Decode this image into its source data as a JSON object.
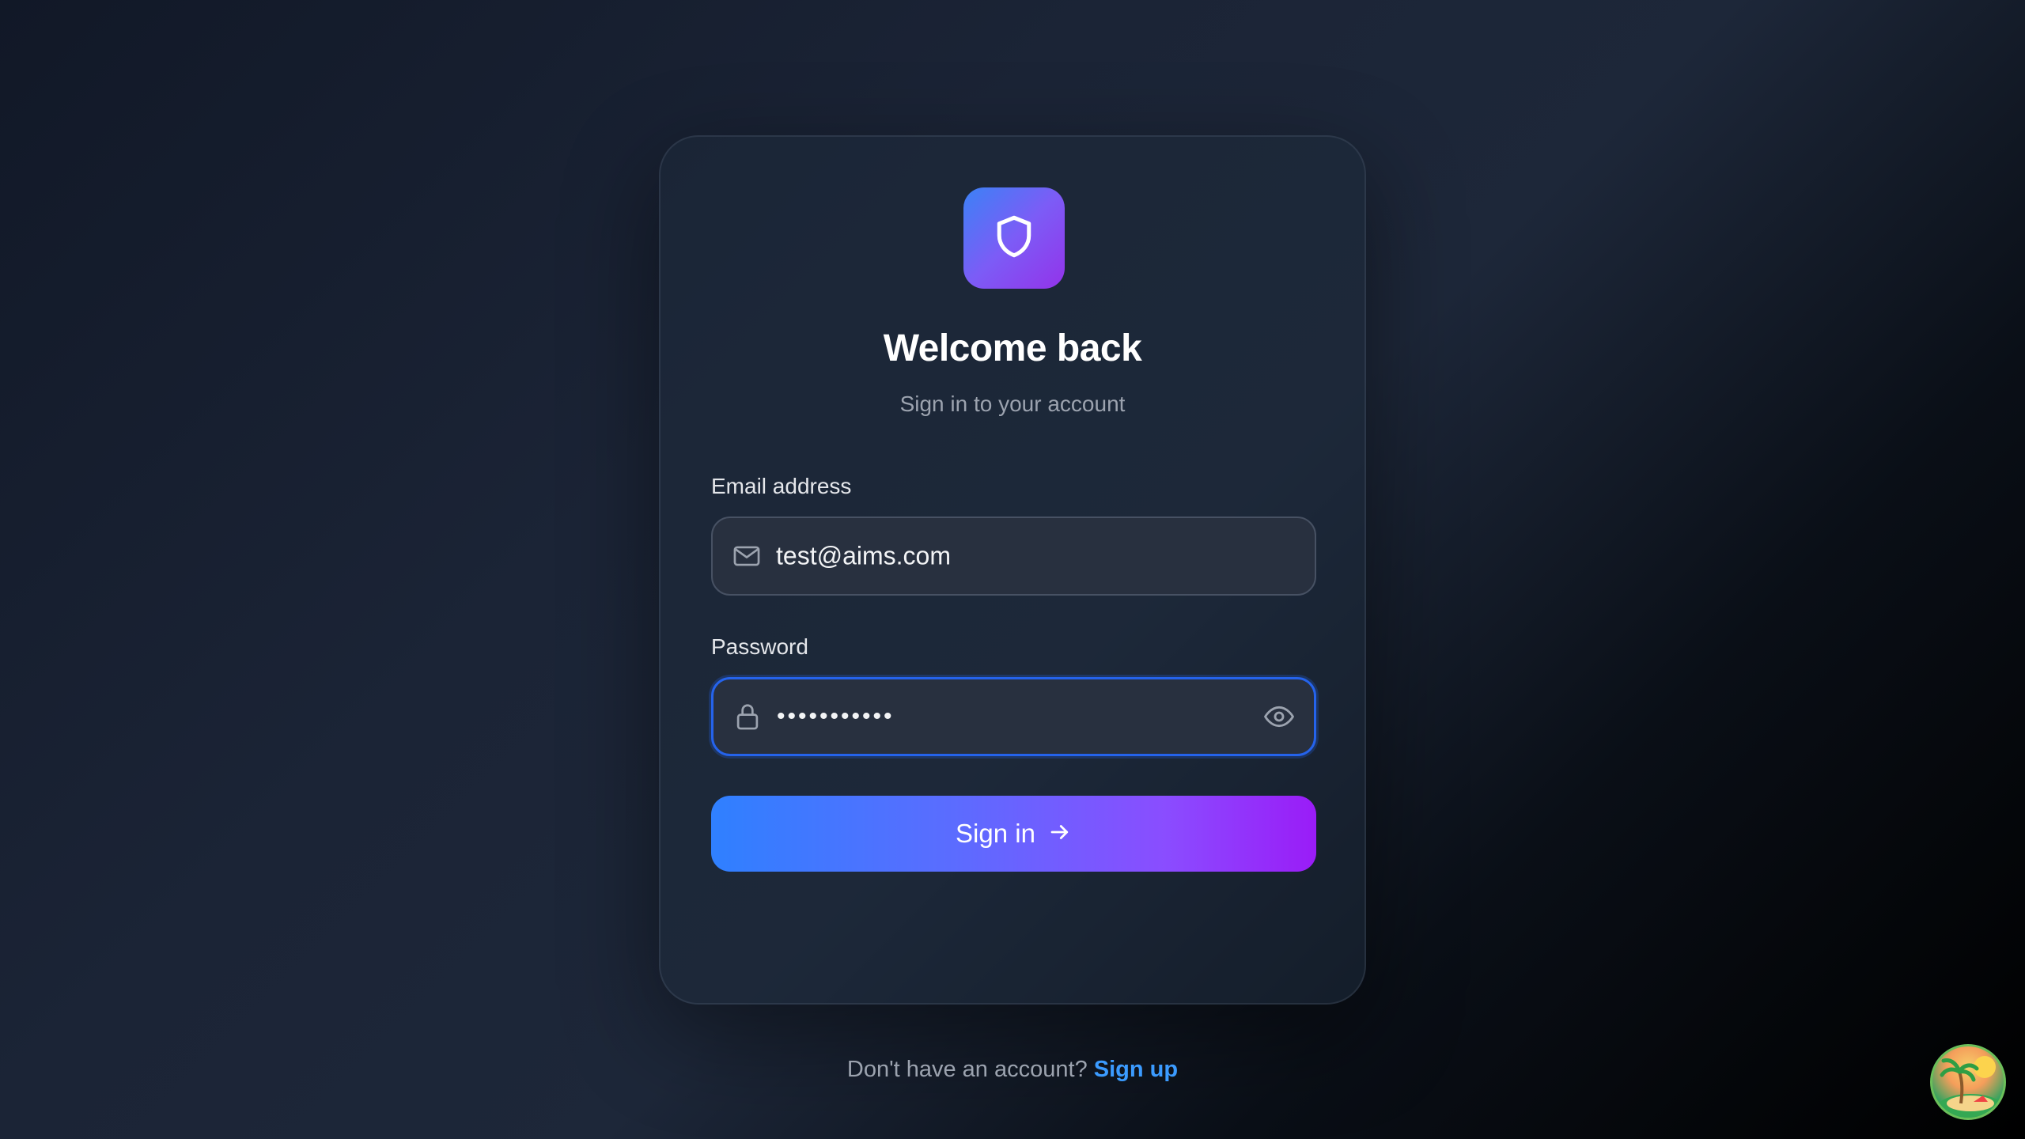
{
  "app": {
    "title": "Welcome back",
    "subtitle": "Sign in to your account",
    "logo_icon": "shield-icon",
    "accent_gradient": [
      "#3b82f6",
      "#9333ea"
    ]
  },
  "form": {
    "email": {
      "label": "Email address",
      "value": "test@aims.com",
      "icon": "mail-icon"
    },
    "password": {
      "label": "Password",
      "value": "•••••••••••",
      "icon": "lock-icon",
      "toggle_icon": "eye-icon"
    },
    "submit": {
      "label": "Sign in",
      "icon": "arrow-right-icon"
    }
  },
  "footer": {
    "prompt": "Don't have an account?",
    "link_label": "Sign up",
    "link_color": "#3b9bff"
  },
  "corner_badge": {
    "icon": "beach-island-icon"
  }
}
